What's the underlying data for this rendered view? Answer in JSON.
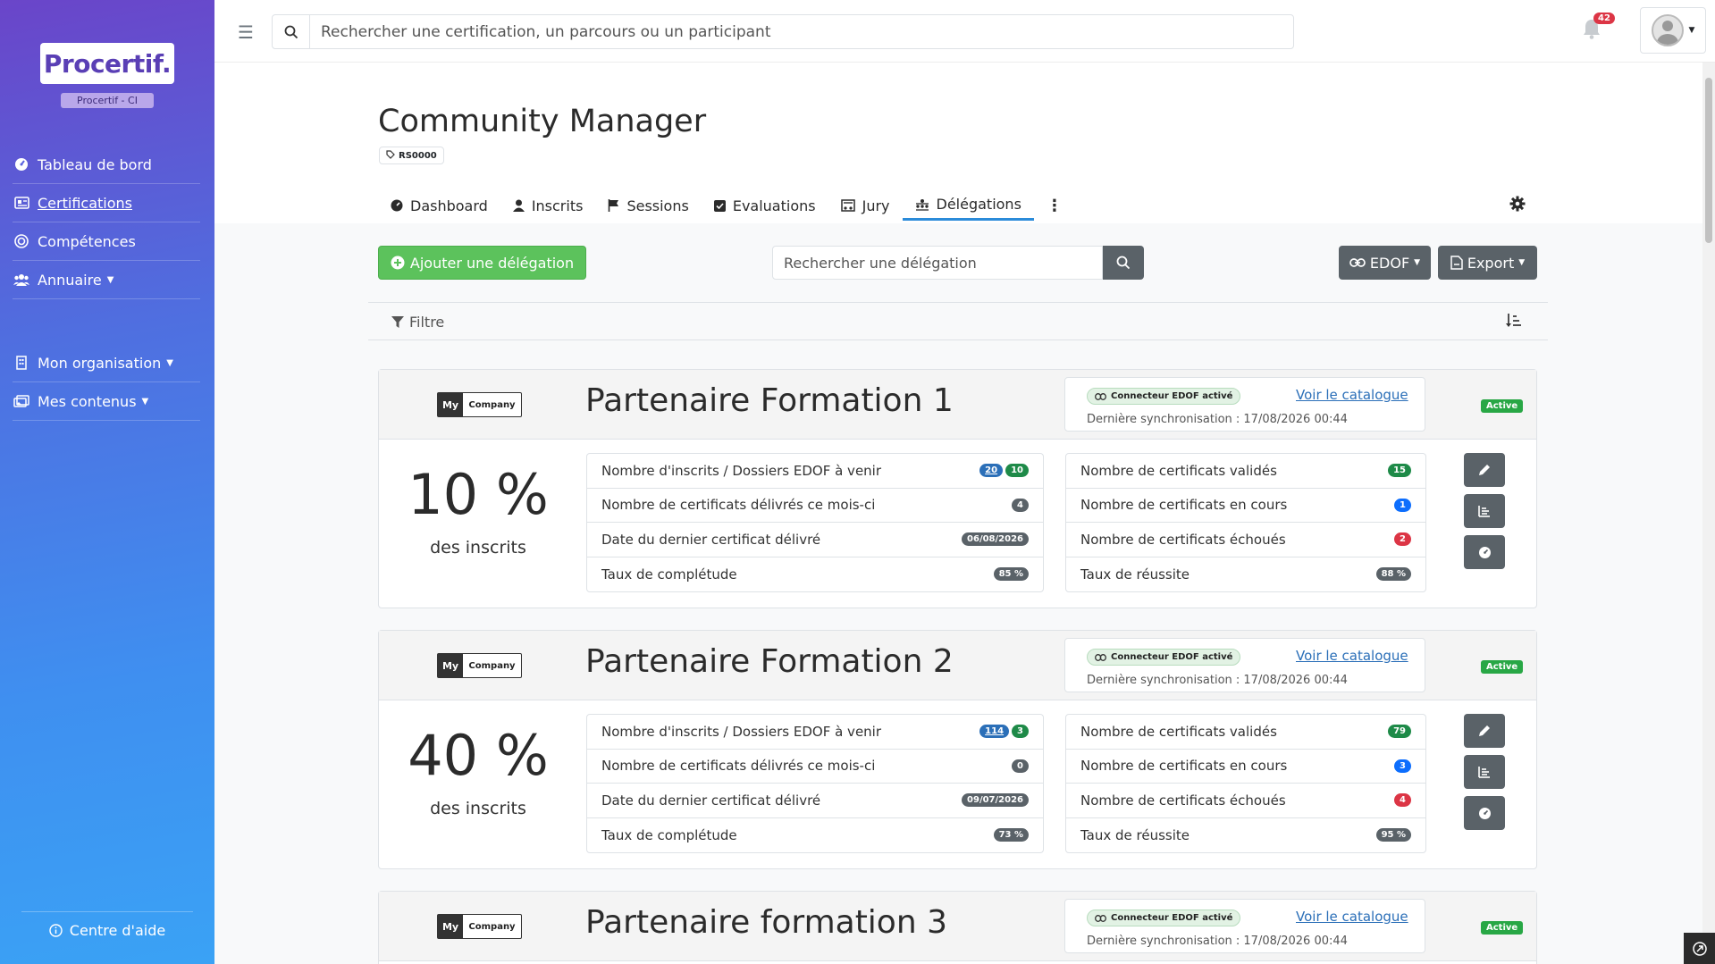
{
  "app": {
    "logo_text": "Procertif.",
    "org_badge": "Procertif - CI"
  },
  "sidebar": {
    "items": [
      {
        "label": "Tableau de bord",
        "icon": "dashboard-icon",
        "active": false,
        "caret": false
      },
      {
        "label": "Certifications",
        "icon": "certificate-icon",
        "active": true,
        "caret": false
      },
      {
        "label": "Compétences",
        "icon": "target-icon",
        "active": false,
        "caret": false
      },
      {
        "label": "Annuaire",
        "icon": "users-icon",
        "active": false,
        "caret": true
      }
    ],
    "items2": [
      {
        "label": "Mon organisation",
        "icon": "building-icon",
        "caret": true
      },
      {
        "label": "Mes contenus",
        "icon": "images-icon",
        "caret": true
      }
    ],
    "help_label": "Centre d'aide"
  },
  "topbar": {
    "search_placeholder": "Rechercher une certification, un parcours ou un participant",
    "notifications": "42"
  },
  "header": {
    "title": "Community Manager",
    "code": "RS0000",
    "tabs": [
      {
        "label": "Dashboard",
        "icon": "dashboard-icon",
        "active": false
      },
      {
        "label": "Inscrits",
        "icon": "user-icon",
        "active": false
      },
      {
        "label": "Sessions",
        "icon": "flag-icon",
        "active": false
      },
      {
        "label": "Evaluations",
        "icon": "checkbox-icon",
        "active": false
      },
      {
        "label": "Jury",
        "icon": "jury-icon",
        "active": false
      },
      {
        "label": "Délégations",
        "icon": "delegation-icon",
        "active": true
      }
    ]
  },
  "toolbar": {
    "add_label": "Ajouter une délégation",
    "search_placeholder": "Rechercher une délégation",
    "edof_label": "EDOF",
    "export_label": "Export",
    "filter_label": "Filtre"
  },
  "colors": {
    "accent": "#2b8bd9",
    "success": "#5cc25c",
    "dark_button": "#5a6268",
    "danger": "#dc3545"
  },
  "delegations": [
    {
      "logo_my": "My",
      "logo_company": "Company",
      "name": "Partenaire Formation 1",
      "connector": "Connecteur EDOF activé",
      "catalog_link": "Voir le catalogue",
      "sync": "Dernière synchronisation : 17/08/2026 00:44",
      "status": "Active",
      "percent": "10 %",
      "percent_sub": "des inscrits",
      "left_stats": [
        {
          "label": "Nombre d'inscrits / Dossiers EDOF à venir",
          "values": [
            "20",
            "10"
          ]
        },
        {
          "label": "Nombre de certificats délivrés ce mois-ci",
          "values": [
            "4"
          ]
        },
        {
          "label": "Date du dernier certificat délivré",
          "values": [
            "06/08/2026"
          ]
        },
        {
          "label": "Taux de complétude",
          "values": [
            "85 %"
          ]
        }
      ],
      "right_stats": [
        {
          "label": "Nombre de certificats validés",
          "value": "15"
        },
        {
          "label": "Nombre de certificats en cours",
          "value": "1"
        },
        {
          "label": "Nombre de certificats échoués",
          "value": "2"
        },
        {
          "label": "Taux de réussite",
          "value": "88 %"
        }
      ]
    },
    {
      "logo_my": "My",
      "logo_company": "Company",
      "name": "Partenaire Formation 2",
      "connector": "Connecteur EDOF activé",
      "catalog_link": "Voir le catalogue",
      "sync": "Dernière synchronisation : 17/08/2026 00:44",
      "status": "Active",
      "percent": "40 %",
      "percent_sub": "des inscrits",
      "left_stats": [
        {
          "label": "Nombre d'inscrits / Dossiers EDOF à venir",
          "values": [
            "114",
            "3"
          ]
        },
        {
          "label": "Nombre de certificats délivrés ce mois-ci",
          "values": [
            "0"
          ]
        },
        {
          "label": "Date du dernier certificat délivré",
          "values": [
            "09/07/2026"
          ]
        },
        {
          "label": "Taux de complétude",
          "values": [
            "73 %"
          ]
        }
      ],
      "right_stats": [
        {
          "label": "Nombre de certificats validés",
          "value": "79"
        },
        {
          "label": "Nombre de certificats en cours",
          "value": "3"
        },
        {
          "label": "Nombre de certificats échoués",
          "value": "4"
        },
        {
          "label": "Taux de réussite",
          "value": "95 %"
        }
      ]
    },
    {
      "logo_my": "My",
      "logo_company": "Company",
      "name": "Partenaire formation 3",
      "connector": "Connecteur EDOF activé",
      "catalog_link": "Voir le catalogue",
      "sync": "Dernière synchronisation : 17/08/2026 00:44",
      "status": "Active"
    }
  ]
}
